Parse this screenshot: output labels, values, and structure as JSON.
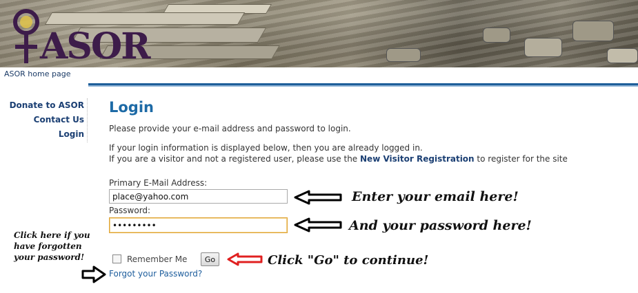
{
  "banner": {
    "logo_text": "ASOR",
    "colors": {
      "logo": "#3d1c4a",
      "accent": "#1f5f9a"
    }
  },
  "nav": {
    "home_link": "ASOR home page",
    "sidebar": [
      {
        "label": "Donate to ASOR"
      },
      {
        "label": "Contact Us"
      },
      {
        "label": "Login"
      }
    ]
  },
  "main": {
    "title": "Login",
    "intro": "Please provide your e-mail address and password to login.",
    "info_line1": "If your login information is displayed below, then you are already logged in.",
    "info_line2_pre": "If you are a visitor and not a registered user, please use the ",
    "info_line2_link": "New Visitor Registration",
    "info_line2_post": " to register for the site"
  },
  "form": {
    "email_label": "Primary E-Mail Address:",
    "email_value": "place@yahoo.com",
    "password_label": "Password:",
    "password_value": "•••••••••",
    "remember_label": "Remember Me",
    "remember_checked": false,
    "go_label": "Go",
    "forgot_link": "Forgot your Password?"
  },
  "annotations": {
    "email": "Enter your email here!",
    "password": "And your password here!",
    "go": "Click \"Go\" to continue!",
    "forgot": "Click here if you have forgotten your password!"
  },
  "icons": [
    "female-symbol-logo-icon",
    "left-arrow-icon",
    "right-arrow-icon"
  ]
}
